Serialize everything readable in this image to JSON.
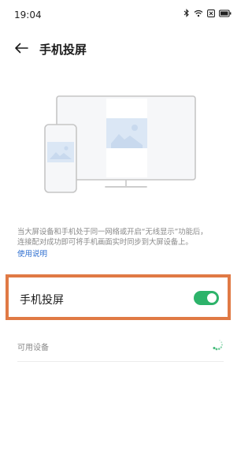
{
  "status_bar": {
    "time": "19:04",
    "icons": [
      "bluetooth-icon",
      "wifi-icon",
      "sim-card-icon",
      "battery-icon"
    ]
  },
  "header": {
    "back_icon": "arrow-left-icon",
    "title": "手机投屏"
  },
  "illustration": {
    "description_icon": "screen-mirror-illustration",
    "colors": {
      "frame": "#c9c9c9",
      "panel": "#f4f5f7",
      "image_accent": "#dbe7f5"
    }
  },
  "description": {
    "lines": [
      "当大屏设备和手机处于同一网络或开启“无线显示”功能后，",
      "连接配对成功即可将手机画面实时同步到大屏设备上。"
    ],
    "help_link": "使用说明"
  },
  "mirror_setting": {
    "label": "手机投屏",
    "enabled": true,
    "toggle_color": "#2db36a",
    "highlight_color": "#e07a45"
  },
  "available_devices": {
    "label": "可用设备",
    "loading": true,
    "spinner_color": "#2db36a"
  }
}
